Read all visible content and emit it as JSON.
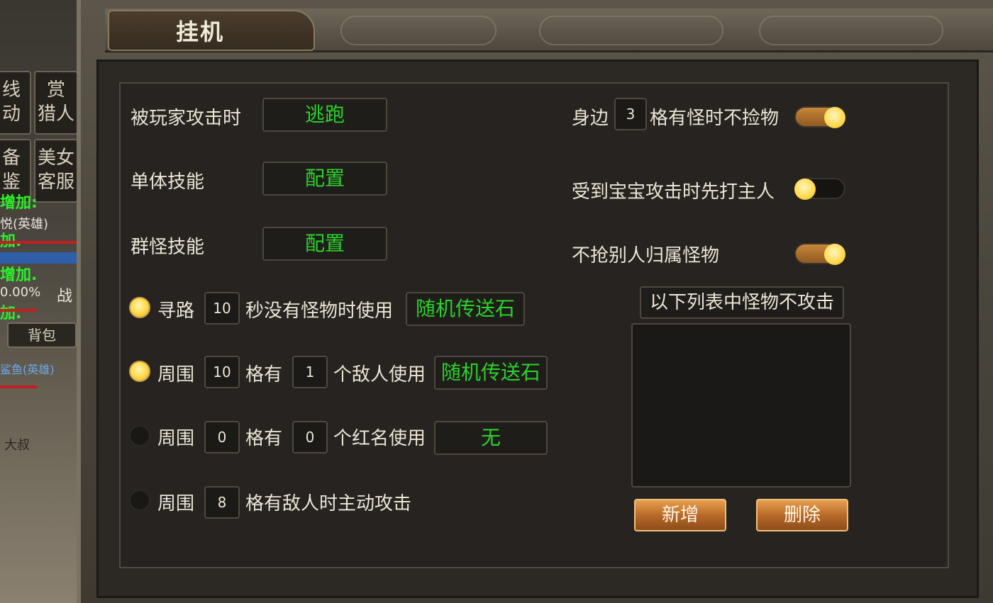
{
  "window": {
    "title": "挂机"
  },
  "left_strip": {
    "menu_cells": [
      {
        "line1": "线",
        "line2": "动"
      },
      {
        "line1": "赏",
        "line2": "猎人"
      },
      {
        "line1": "备",
        "line2": "鉴"
      },
      {
        "line1": "美女",
        "line2": "客服"
      }
    ],
    "green_text_1": "增加:",
    "hero_name_1": "悦(英雄)",
    "green_text_2": "加.",
    "green_text_3": "增加.",
    "percent": "0.00%",
    "battle_label": "战",
    "green_text_4": "加.",
    "pack_button": "背包",
    "hero_name_2": "鲨鱼(英雄)",
    "npc_label": "大叔"
  },
  "left_column": {
    "attacked_by_player": {
      "label": "被玩家攻击时",
      "value": "逃跑"
    },
    "single_skill": {
      "label": "单体技能",
      "value": "配置"
    },
    "group_skill": {
      "label": "群怪技能",
      "value": "配置"
    },
    "row_pathfind": {
      "enabled": true,
      "label_a": "寻路",
      "seconds": "10",
      "label_b": "秒没有怪物时使用",
      "item": "随机传送石"
    },
    "row_enemy": {
      "enabled": true,
      "label_a": "周围",
      "range": "10",
      "label_b": "格有",
      "count": "1",
      "label_c": "个敌人使用",
      "item": "随机传送石"
    },
    "row_redname": {
      "enabled": false,
      "label_a": "周围",
      "range": "0",
      "label_b": "格有",
      "count": "0",
      "label_c": "个红名使用",
      "item": "无"
    },
    "row_attack": {
      "enabled": false,
      "label_a": "周围",
      "range": "8",
      "label_b": "格有敌人时主动攻击"
    }
  },
  "right_column": {
    "no_pickup": {
      "label_a": "身边",
      "range": "3",
      "label_b": "格有怪时不捡物",
      "enabled": true
    },
    "attack_owner": {
      "label": "受到宝宝攻击时先打主人",
      "enabled": false
    },
    "no_steal": {
      "label": "不抢别人归属怪物",
      "enabled": true
    },
    "ignore_list": {
      "header": "以下列表中怪物不攻击",
      "items": []
    },
    "add_button": "新增",
    "delete_button": "删除"
  },
  "colors": {
    "accent_green": "#2bd32b",
    "toggle_on": "#c88638",
    "knob": "#ffd84a",
    "button_orange": "#b86a28"
  }
}
